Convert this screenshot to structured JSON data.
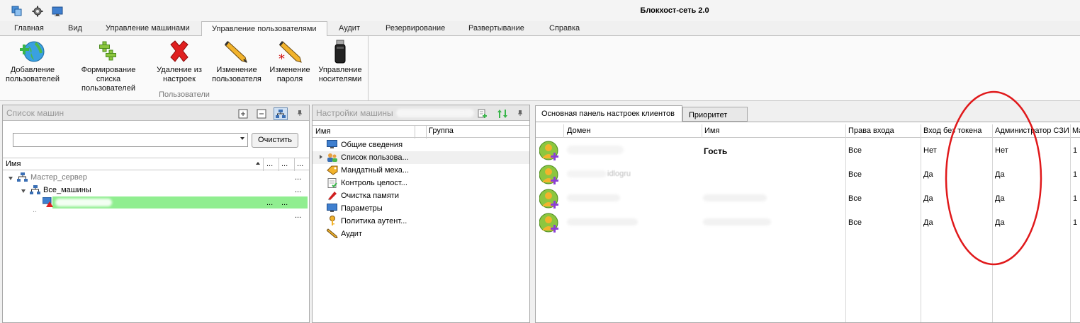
{
  "app": {
    "title": "Блокхост-сеть 2.0"
  },
  "menu": {
    "tabs": [
      "Главная",
      "Вид",
      "Управление машинами",
      "Управление пользователями",
      "Аудит",
      "Резервирование",
      "Развертывание",
      "Справка"
    ]
  },
  "ribbon": {
    "group_label": "Пользователи",
    "buttons": [
      {
        "line1": "Добавление",
        "line2": "пользователей",
        "icon": "add-users-globe-icon"
      },
      {
        "line1": "Формирование списка",
        "line2": "пользователей",
        "icon": "add-list-icon"
      },
      {
        "line1": "Удаление из",
        "line2": "настроек",
        "icon": "red-x-icon"
      },
      {
        "line1": "Изменение",
        "line2": "пользователя",
        "icon": "pencil-icon"
      },
      {
        "line1": "Изменение",
        "line2": "пароля",
        "icon": "pencil-star-icon"
      },
      {
        "line1": "Управление",
        "line2": "носителями",
        "icon": "usb-token-icon"
      }
    ]
  },
  "machines_panel": {
    "title": "Список машин",
    "clear_button": "Очистить",
    "column_name": "Имя",
    "ellipsis": "...",
    "tree": [
      {
        "label": "Мастер_сервер"
      },
      {
        "label": "Все_машины"
      }
    ]
  },
  "settings_panel": {
    "title": "Настройки машины",
    "columns": [
      "Имя",
      "Группа"
    ],
    "items": [
      "Общие сведения",
      "Список пользова...",
      "Мандатный меха...",
      "Контроль целост...",
      "Очистка памяти",
      "Параметры",
      "Политика аутент...",
      "Аудит"
    ]
  },
  "clients_panel": {
    "tabs": [
      "Основная панель настроек клиентов",
      "Приоритет"
    ],
    "columns": [
      "Домен",
      "Имя",
      "Права входа",
      "Вход без токена",
      "Администратор СЗИ",
      "Ма"
    ],
    "rows": [
      {
        "name": "Гость",
        "rights": "Все",
        "no_token": "Нет",
        "admin": "Нет",
        "last": "1"
      },
      {
        "name": "",
        "rights": "Все",
        "no_token": "Да",
        "admin": "Да",
        "last": "1"
      },
      {
        "name": "",
        "rights": "Все",
        "no_token": "Да",
        "admin": "Да",
        "last": "1"
      },
      {
        "name": "",
        "rights": "Все",
        "no_token": "Да",
        "admin": "Да",
        "last": "1"
      }
    ],
    "row_fragment": "idlogru"
  },
  "colors": {
    "highlight": "#90ee90",
    "annotation": "#e0191b"
  }
}
